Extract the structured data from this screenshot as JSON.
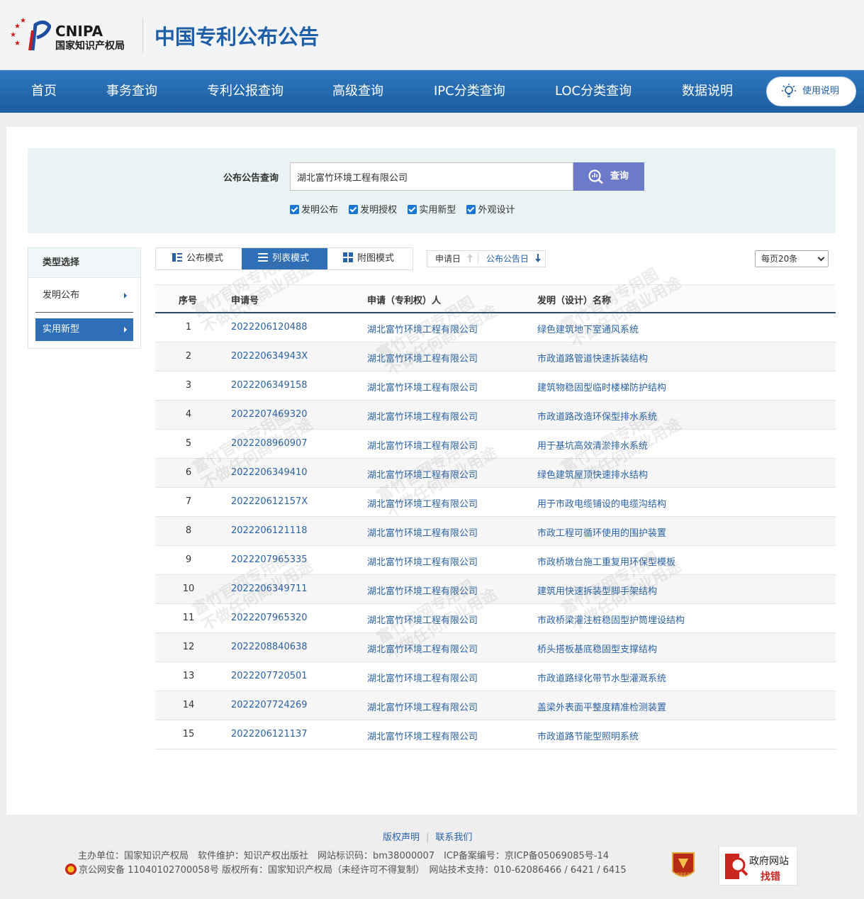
{
  "header": {
    "logo_en": "CNIPA",
    "logo_cn": "国家知识产权局",
    "site_title": "中国专利公布公告"
  },
  "nav": {
    "items": [
      "首页",
      "事务查询",
      "专利公报查询",
      "高级查询",
      "IPC分类查询",
      "LOC分类查询",
      "数据说明"
    ],
    "help_label": "使用说明"
  },
  "search": {
    "label": "公布公告查询",
    "value": "湖北富竹环境工程有限公司",
    "button_label": "查询",
    "checkboxes": [
      {
        "label": "发明公布",
        "checked": true
      },
      {
        "label": "发明授权",
        "checked": true
      },
      {
        "label": "实用新型",
        "checked": true
      },
      {
        "label": "外观设计",
        "checked": true
      }
    ]
  },
  "sidebar": {
    "title": "类型选择",
    "items": [
      {
        "label": "发明公布",
        "active": false
      },
      {
        "label": "实用新型",
        "active": true
      }
    ]
  },
  "toolbar": {
    "modes": [
      "公布模式",
      "列表模式",
      "附图模式"
    ],
    "active_mode": "列表模式",
    "sorts": [
      "申请日",
      "公布公告日"
    ],
    "per_page": "每页20条"
  },
  "table": {
    "headers": [
      "序号",
      "申请号",
      "申请（专利权）人",
      "发明（设计）名称"
    ],
    "rows": [
      {
        "no": "1",
        "app": "2022206120488",
        "owner": "湖北富竹环境工程有限公司",
        "name": "绿色建筑地下室通风系统"
      },
      {
        "no": "2",
        "app": "202220634943X",
        "owner": "湖北富竹环境工程有限公司",
        "name": "市政道路管道快速拆装结构"
      },
      {
        "no": "3",
        "app": "2022206349158",
        "owner": "湖北富竹环境工程有限公司",
        "name": "建筑物稳固型临时楼梯防护结构"
      },
      {
        "no": "4",
        "app": "2022207469320",
        "owner": "湖北富竹环境工程有限公司",
        "name": "市政道路改造环保型排水系统"
      },
      {
        "no": "5",
        "app": "2022208960907",
        "owner": "湖北富竹环境工程有限公司",
        "name": "用于基坑高效清淤排水系统"
      },
      {
        "no": "6",
        "app": "2022206349410",
        "owner": "湖北富竹环境工程有限公司",
        "name": "绿色建筑屋顶快速排水结构"
      },
      {
        "no": "7",
        "app": "202220612157X",
        "owner": "湖北富竹环境工程有限公司",
        "name": "用于市政电缆铺设的电缆沟结构"
      },
      {
        "no": "8",
        "app": "2022206121118",
        "owner": "湖北富竹环境工程有限公司",
        "name": "市政工程可循环使用的围护装置"
      },
      {
        "no": "9",
        "app": "2022207965335",
        "owner": "湖北富竹环境工程有限公司",
        "name": "市政桥墩台施工重复用环保型模板"
      },
      {
        "no": "10",
        "app": "2022206349711",
        "owner": "湖北富竹环境工程有限公司",
        "name": "建筑用快速拆装型脚手架结构"
      },
      {
        "no": "11",
        "app": "2022207965320",
        "owner": "湖北富竹环境工程有限公司",
        "name": "市政桥梁灌注桩稳固型护筒埋设结构"
      },
      {
        "no": "12",
        "app": "2022208840638",
        "owner": "湖北富竹环境工程有限公司",
        "name": "桥头搭板基底稳固型支撑结构"
      },
      {
        "no": "13",
        "app": "2022207720501",
        "owner": "湖北富竹环境工程有限公司",
        "name": "市政道路绿化带节水型灌溉系统"
      },
      {
        "no": "14",
        "app": "2022207724269",
        "owner": "湖北富竹环境工程有限公司",
        "name": "盖梁外表面平整度精准检测装置"
      },
      {
        "no": "15",
        "app": "2022206121137",
        "owner": "湖北富竹环境工程有限公司",
        "name": "市政道路节能型照明系统"
      }
    ]
  },
  "watermark": {
    "line1": "富竹官网专用图",
    "line2": "不做任何商业用途"
  },
  "footer": {
    "links": [
      "版权声明",
      "联系我们"
    ],
    "line1": "主办单位：国家知识产权局　软件维护：知识产权出版社　网站标识码：bm38000007　ICP备案编号：京ICP备05069085号-14",
    "line2": "京公网安备 11040102700058号 版权所有：国家知识产权局（未经许可不得复制）　网站技术支持：010-62086466 / 6421 / 6415",
    "gov_badge_line1": "政府网站",
    "gov_badge_line2": "找错",
    "party_badge_text": "党政机关"
  }
}
